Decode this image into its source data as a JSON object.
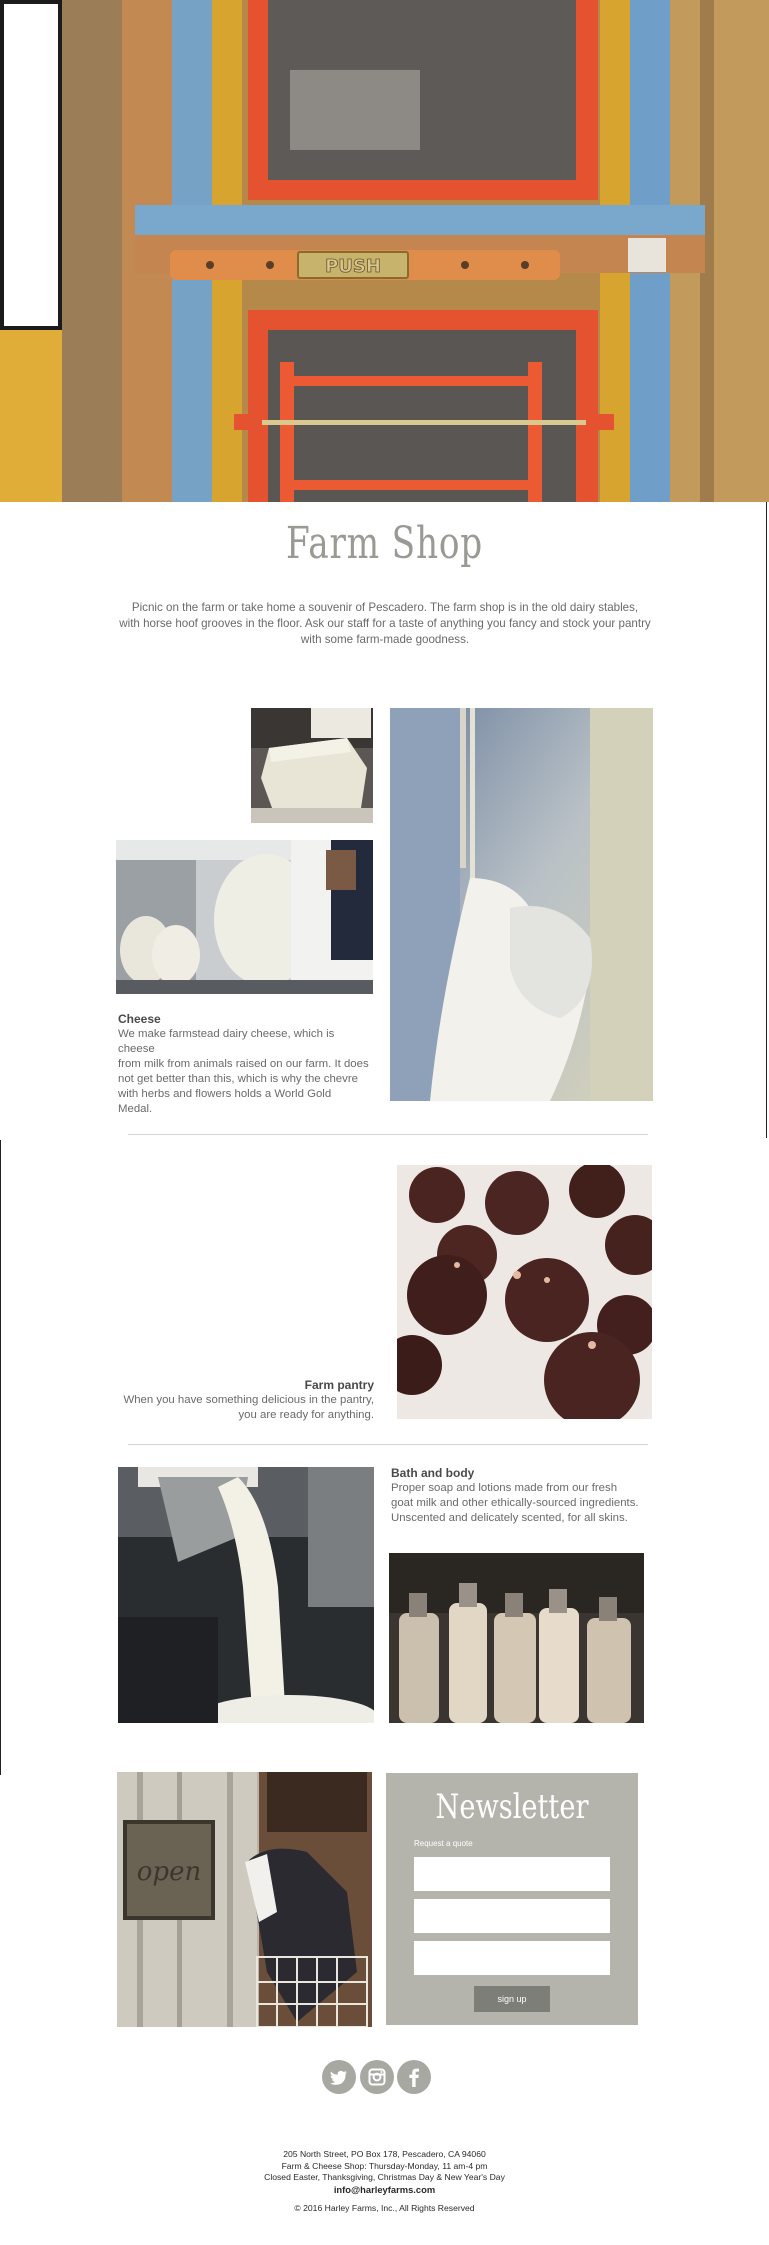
{
  "hero": {
    "alt": "Weathered painted barn door with PUSH sign",
    "push_text": "PUSH"
  },
  "intro": {
    "title": "Farm Shop",
    "lines": [
      "Picnic on the farm or take home a souvenir of Pescadero. The farm shop is in the old dairy stables,",
      "with horse hoof grooves in the floor. Ask our staff for a taste of anything you fancy and stock your pantry",
      "with some farm-made goodness."
    ]
  },
  "cheese": {
    "heading": "Cheese",
    "lines": [
      "We make farmstead dairy cheese, which is cheese",
      "from milk from animals raised on our farm. It does",
      "not get better than this, which is why the chevre",
      "with herbs and flowers holds a World Gold",
      "Medal."
    ]
  },
  "pantry": {
    "heading": "Farm pantry",
    "lines": [
      "When you have something delicious in the pantry,",
      "you are ready for anything."
    ]
  },
  "bath": {
    "heading": "Bath and body",
    "lines": [
      "Proper soap and lotions made from our fresh",
      "goat milk and other ethically-sourced ingredients.",
      "Unscented and delicately scented, for all skins."
    ]
  },
  "open_sign_text": "open",
  "newsletter": {
    "title": "Newsletter",
    "subtitle": "Request a quote",
    "fields": [
      "",
      "",
      ""
    ],
    "button_label": "sign up"
  },
  "social": [
    "twitter-icon",
    "instagram-icon",
    "facebook-icon"
  ],
  "footer": {
    "address": "205 North Street, PO Box 178, Pescadero, CA 94060",
    "hours": "Farm & Cheese Shop: Thursday-Monday, 11 am-4 pm",
    "closed": "Closed Easter, Thanksgiving, Christmas Day & New Year's Day",
    "email": "info@harleyfarms.com",
    "copyright": "© 2016 Harley Farms, Inc., All Rights Reserved"
  },
  "colors": {
    "accent_gray": "#b4b4ad",
    "button_gray": "#7e7e78",
    "door_red": "#e0502e",
    "door_blue": "#6f9fc9",
    "door_yellow": "#d9a531"
  }
}
